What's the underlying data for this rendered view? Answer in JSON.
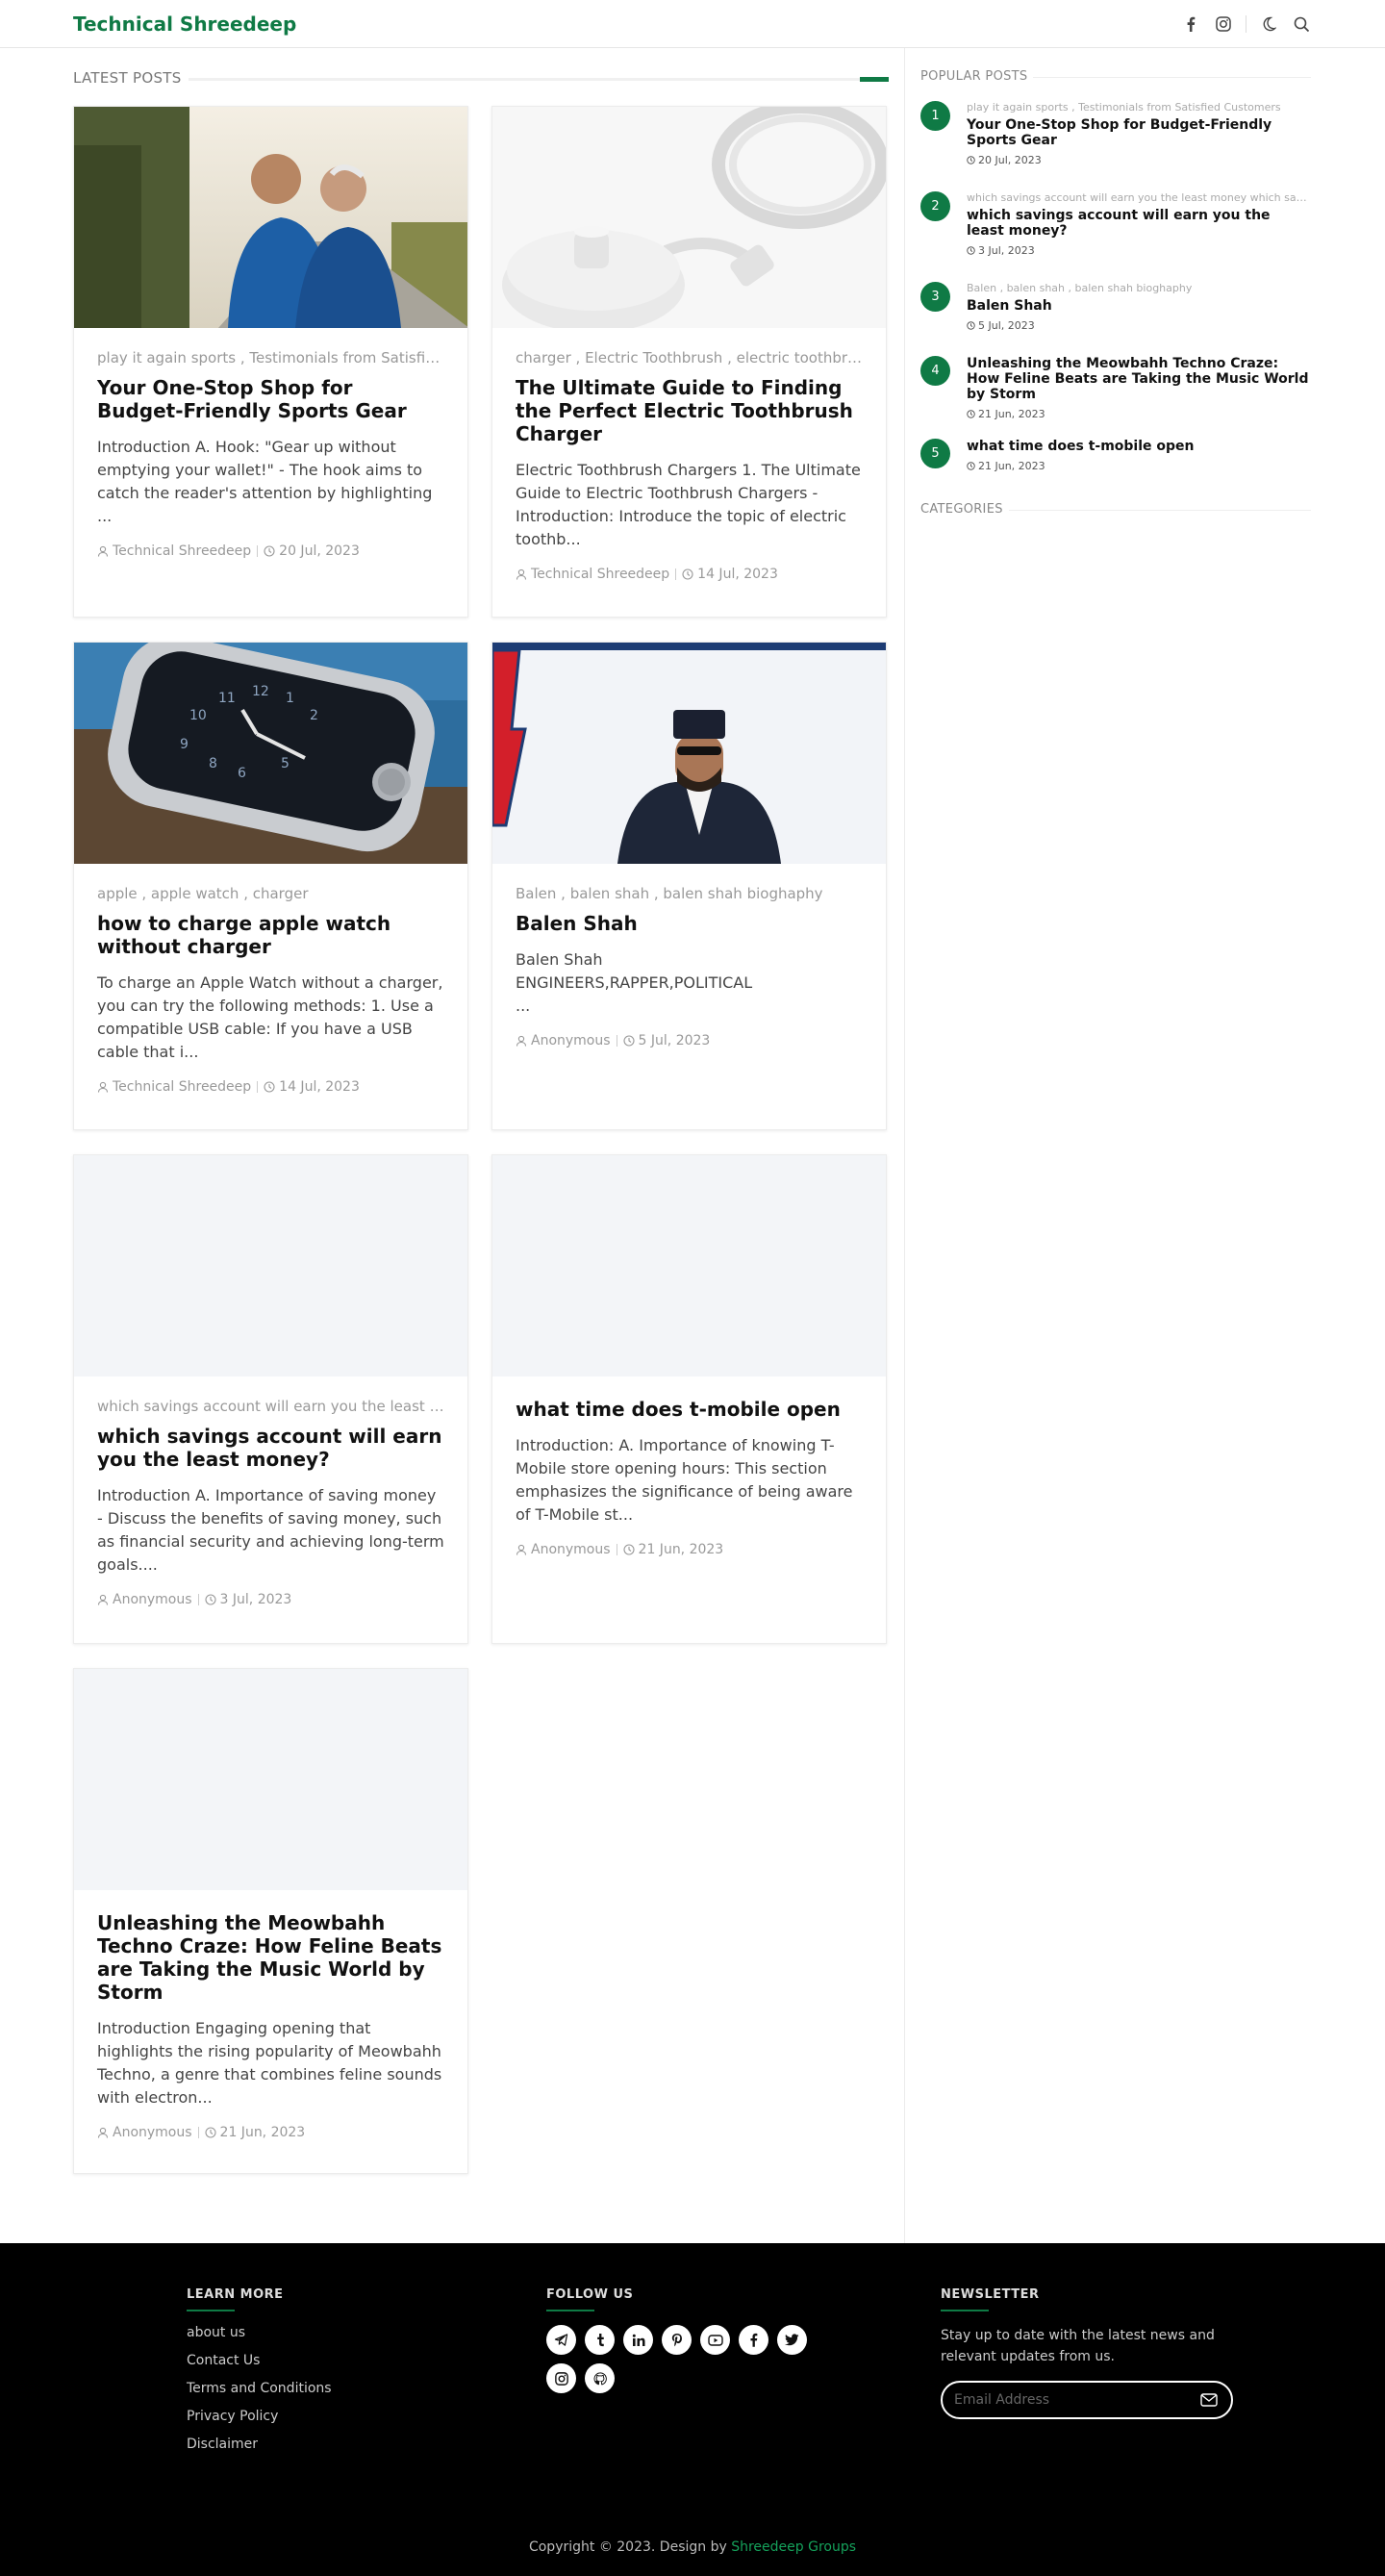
{
  "site": {
    "brand": "Technical Shreedeep"
  },
  "header": {
    "icons": [
      "facebook-icon",
      "instagram-icon",
      "moon-icon",
      "search-icon"
    ]
  },
  "main": {
    "section_title": "LATEST POSTS",
    "posts": [
      {
        "tags": "play it again sports , Testimonials from Satisfied Customers",
        "title": "Your One-Stop Shop for Budget-Friendly Sports Gear",
        "excerpt": "Introduction A. Hook: \"Gear up without emptying your wallet!\" - The hook aims to catch the reader's attention by highlighting ...",
        "author": "Technical Shreedeep",
        "date": "20 Jul, 2023"
      },
      {
        "tags": "charger , Electric Toothbrush , electric toothbrush charger",
        "title": "The Ultimate Guide to Finding the Perfect Electric Toothbrush Charger",
        "excerpt": "Electric Toothbrush Chargers 1. The Ultimate Guide to Electric Toothbrush Chargers    -Introduction: Introduce the topic of electric toothb...",
        "author": "Technical Shreedeep",
        "date": "14 Jul, 2023"
      },
      {
        "tags": "apple , apple watch , charger",
        "title": "how to charge apple watch without charger",
        "excerpt": "To charge an Apple Watch without a charger, you can try the following methods: 1. Use a compatible USB cable: If you have a USB cable that i...",
        "author": "Technical Shreedeep",
        "date": "14 Jul, 2023"
      },
      {
        "tags": "Balen , balen shah , balen shah bioghaphy",
        "title": "Balen Shah",
        "excerpt": "Balen Shah\n ENGINEERS,RAPPER,POLITICAL\n                                  ...",
        "author": "Anonymous",
        "date": "5 Jul, 2023"
      },
      {
        "tags": "which savings account will earn you the least money",
        "title": "which savings account will earn you the least money?",
        "excerpt": "Introduction A. Importance of saving money - Discuss the benefits of saving money, such as financial security and achieving long-term goals....",
        "author": "Anonymous",
        "date": "3 Jul, 2023"
      },
      {
        "tags": "",
        "title": "what time does t-mobile open",
        "excerpt": "Introduction: A. Importance of knowing T-Mobile store opening hours:  This section emphasizes the significance of being aware of T-Mobile st...",
        "author": "Anonymous",
        "date": "21 Jun, 2023"
      },
      {
        "tags": "",
        "title": "Unleashing the Meowbahh Techno Craze: How Feline Beats are Taking the Music World by Storm",
        "excerpt": "Introduction Engaging opening that highlights the rising popularity of Meowbahh Techno, a genre that combines feline sounds with electron...",
        "author": "Anonymous",
        "date": "21 Jun, 2023"
      }
    ]
  },
  "sidebar": {
    "popular_title": "POPULAR POSTS",
    "categories_title": "CATEGORIES",
    "popular": [
      {
        "num": "1",
        "tags": "play it again sports , Testimonials from Satisfied Customers",
        "title": "Your One-Stop Shop for Budget-Friendly Sports Gear",
        "date": "20 Jul, 2023"
      },
      {
        "num": "2",
        "tags": "which savings account will earn you the least money which savings account",
        "title": "which savings account will earn you the least money?",
        "date": "3 Jul, 2023"
      },
      {
        "num": "3",
        "tags": "Balen , balen shah , balen shah bioghaphy",
        "title": "Balen Shah",
        "date": "5 Jul, 2023"
      },
      {
        "num": "4",
        "tags": "",
        "title": "Unleashing the Meowbahh Techno Craze: How Feline Beats are Taking the Music World by Storm",
        "date": "21 Jun, 2023"
      },
      {
        "num": "5",
        "tags": "",
        "title": "what time does t-mobile open",
        "date": "21 Jun, 2023"
      }
    ]
  },
  "footer": {
    "learn_more": {
      "title": "LEARN MORE",
      "links": [
        "about us",
        "Contact Us",
        "Terms and Conditions",
        "Privacy Policy",
        "Disclaimer"
      ]
    },
    "follow_us": {
      "title": "FOLLOW US",
      "icons": [
        "telegram-icon",
        "tumblr-icon",
        "linkedin-icon",
        "pinterest-icon",
        "youtube-icon",
        "facebook-icon",
        "twitter-icon",
        "instagram-icon",
        "github-icon"
      ]
    },
    "newsletter": {
      "title": "NEWSLETTER",
      "text": "Stay up to date with the latest news and relevant updates from us.",
      "placeholder": "Email Address"
    },
    "copyright_prefix": "Copyright © 2023. Design by ",
    "copyright_link": "Shreedeep Groups"
  },
  "colors": {
    "accent": "#0f7a45",
    "footer_bg": "#000000",
    "thumb_placeholder": "#f3f5f8"
  }
}
